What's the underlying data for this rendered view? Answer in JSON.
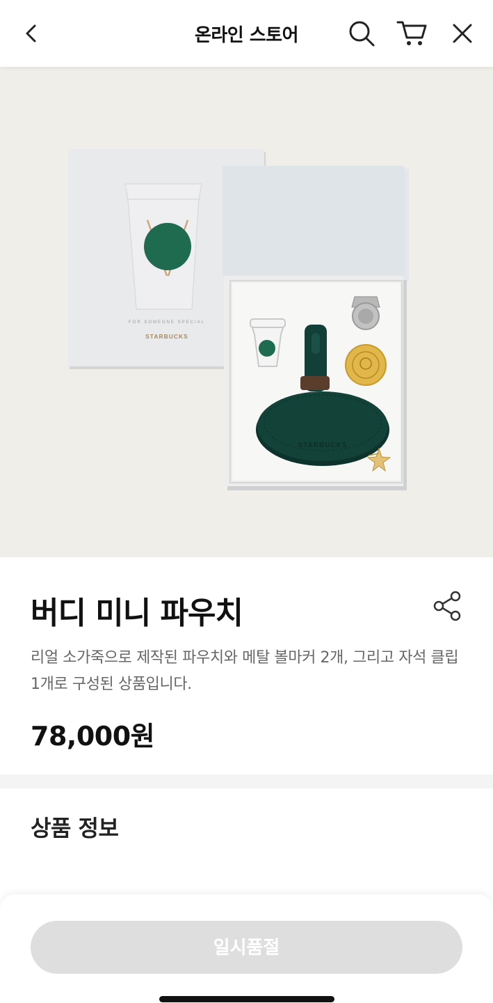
{
  "header": {
    "title": "온라인 스토어",
    "back_icon": "chevron-left-icon",
    "search_icon": "search-icon",
    "cart_icon": "cart-icon",
    "close_icon": "close-icon"
  },
  "product": {
    "image_logo_text": "STARBUCKS",
    "name": "버디 미니 파우치",
    "description": "리얼 소가죽으로 제작된 파우치와 메탈 볼마커 2개, 그리고 자석 클립 1개로 구성된 상품입니다.",
    "price": "78,000원",
    "share_icon": "share-icon"
  },
  "sections": {
    "info_title": "상품 정보"
  },
  "actions": {
    "soldout_label": "일시품절"
  },
  "colors": {
    "brand_green": "#1e6b4f",
    "pouch_green": "#123f38",
    "soldout_bg": "#dedede",
    "hero_bg": "#f0eee9"
  }
}
